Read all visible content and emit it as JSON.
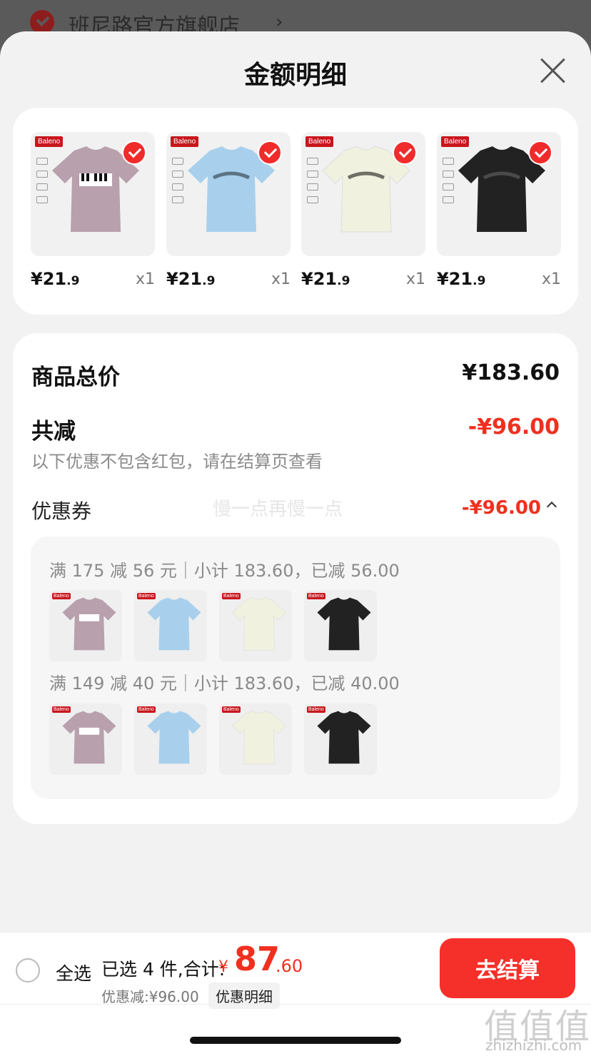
{
  "store": {
    "name": "班尼路官方旗舰店",
    "arrow": "›"
  },
  "sheet": {
    "title": "金额明细"
  },
  "products": [
    {
      "brand": "Baleno",
      "color": "#b8a0ad",
      "price_int": "¥21",
      "price_dec": ".9",
      "qty": "x1",
      "print": "piano"
    },
    {
      "brand": "Baleno",
      "color": "#a8d0ec",
      "price_int": "¥21",
      "price_dec": ".9",
      "qty": "x1",
      "print": "HIT FACTORY"
    },
    {
      "brand": "Baleno",
      "color": "#f1f1df",
      "price_int": "¥21",
      "price_dec": ".9",
      "qty": "x1",
      "print": "HIT FACTORY"
    },
    {
      "brand": "Baleno",
      "color": "#222222",
      "price_int": "¥21",
      "price_dec": ".9",
      "qty": "x1",
      "print": "HIT FACTORY"
    }
  ],
  "summary": {
    "total_label": "商品总价",
    "total_value": "¥183.60",
    "reduce_label": "共减",
    "reduce_value": "-¥96.00",
    "note": "以下优惠不包含红包，请在结算页查看",
    "coupon_label": "优惠券",
    "coupon_value": "-¥96.00",
    "watermark": "慢一点再慢一点"
  },
  "rules": [
    {
      "text": "满 175 减 56 元｜小计 183.60，已减 56.00"
    },
    {
      "text": "满 149 减 40 元｜小计 183.60，已减 40.00"
    }
  ],
  "bottom": {
    "select_all": "全选",
    "selected": "已选 4 件,合计:",
    "yen": "¥",
    "total_int": "87",
    "total_dec": ".60",
    "discount": "优惠减:¥96.00",
    "detail": "优惠明细",
    "checkout": "去结算"
  },
  "site": {
    "mark": "值值值",
    "url": "zhizhizhi.com"
  },
  "colors": {
    "accent_red": "#f0301f",
    "button_red": "#f5302a"
  }
}
